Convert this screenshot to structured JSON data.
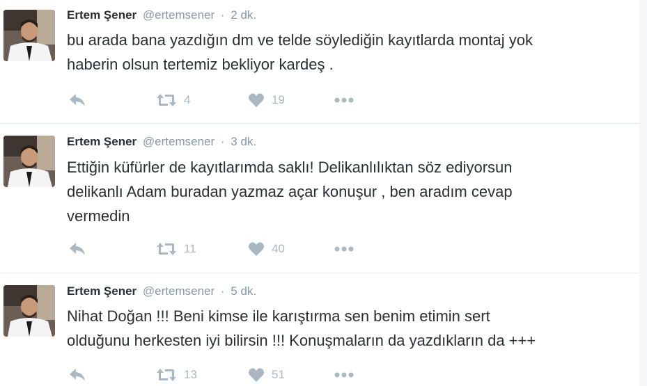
{
  "tweets": [
    {
      "fullname": "Ertem Şener",
      "username": "@ertemsener",
      "separator": "·",
      "time": "2 dk.",
      "text_lines": [
        "bu arada bana yazdığın dm ve telde söylediğin kayıtlarda montaj yok",
        "haberin olsun tertemiz bekliyor kardeş ."
      ],
      "retweets": "4",
      "likes": "19"
    },
    {
      "fullname": "Ertem Şener",
      "username": "@ertemsener",
      "separator": "·",
      "time": "3 dk.",
      "text_lines": [
        "Ettiğin küfürler de kayıtlarımda saklı! Delikanlılıktan söz ediyorsun",
        "delikanlı Adam buradan yazmaz açar konuşur , ben aradım cevap",
        "vermedin"
      ],
      "retweets": "11",
      "likes": "40"
    },
    {
      "fullname": "Ertem Şener",
      "username": "@ertemsener",
      "separator": "·",
      "time": "5 dk.",
      "text_lines": [
        "Nihat Doğan !!! Beni kimse ile karıştırma sen benim etimin sert",
        "olduğunu herkesten iyi bilirsin !!!  Konuşmaların da yazdıkların da +++"
      ],
      "retweets": "13",
      "likes": "51"
    }
  ],
  "icons": {
    "reply": "reply-icon",
    "retweet": "retweet-icon",
    "like": "heart-icon",
    "more": "more-dots-icon"
  },
  "colors": {
    "text": "#292f33",
    "muted": "#8899a6",
    "action": "#aab8c2",
    "divider": "#e1e8ed"
  }
}
